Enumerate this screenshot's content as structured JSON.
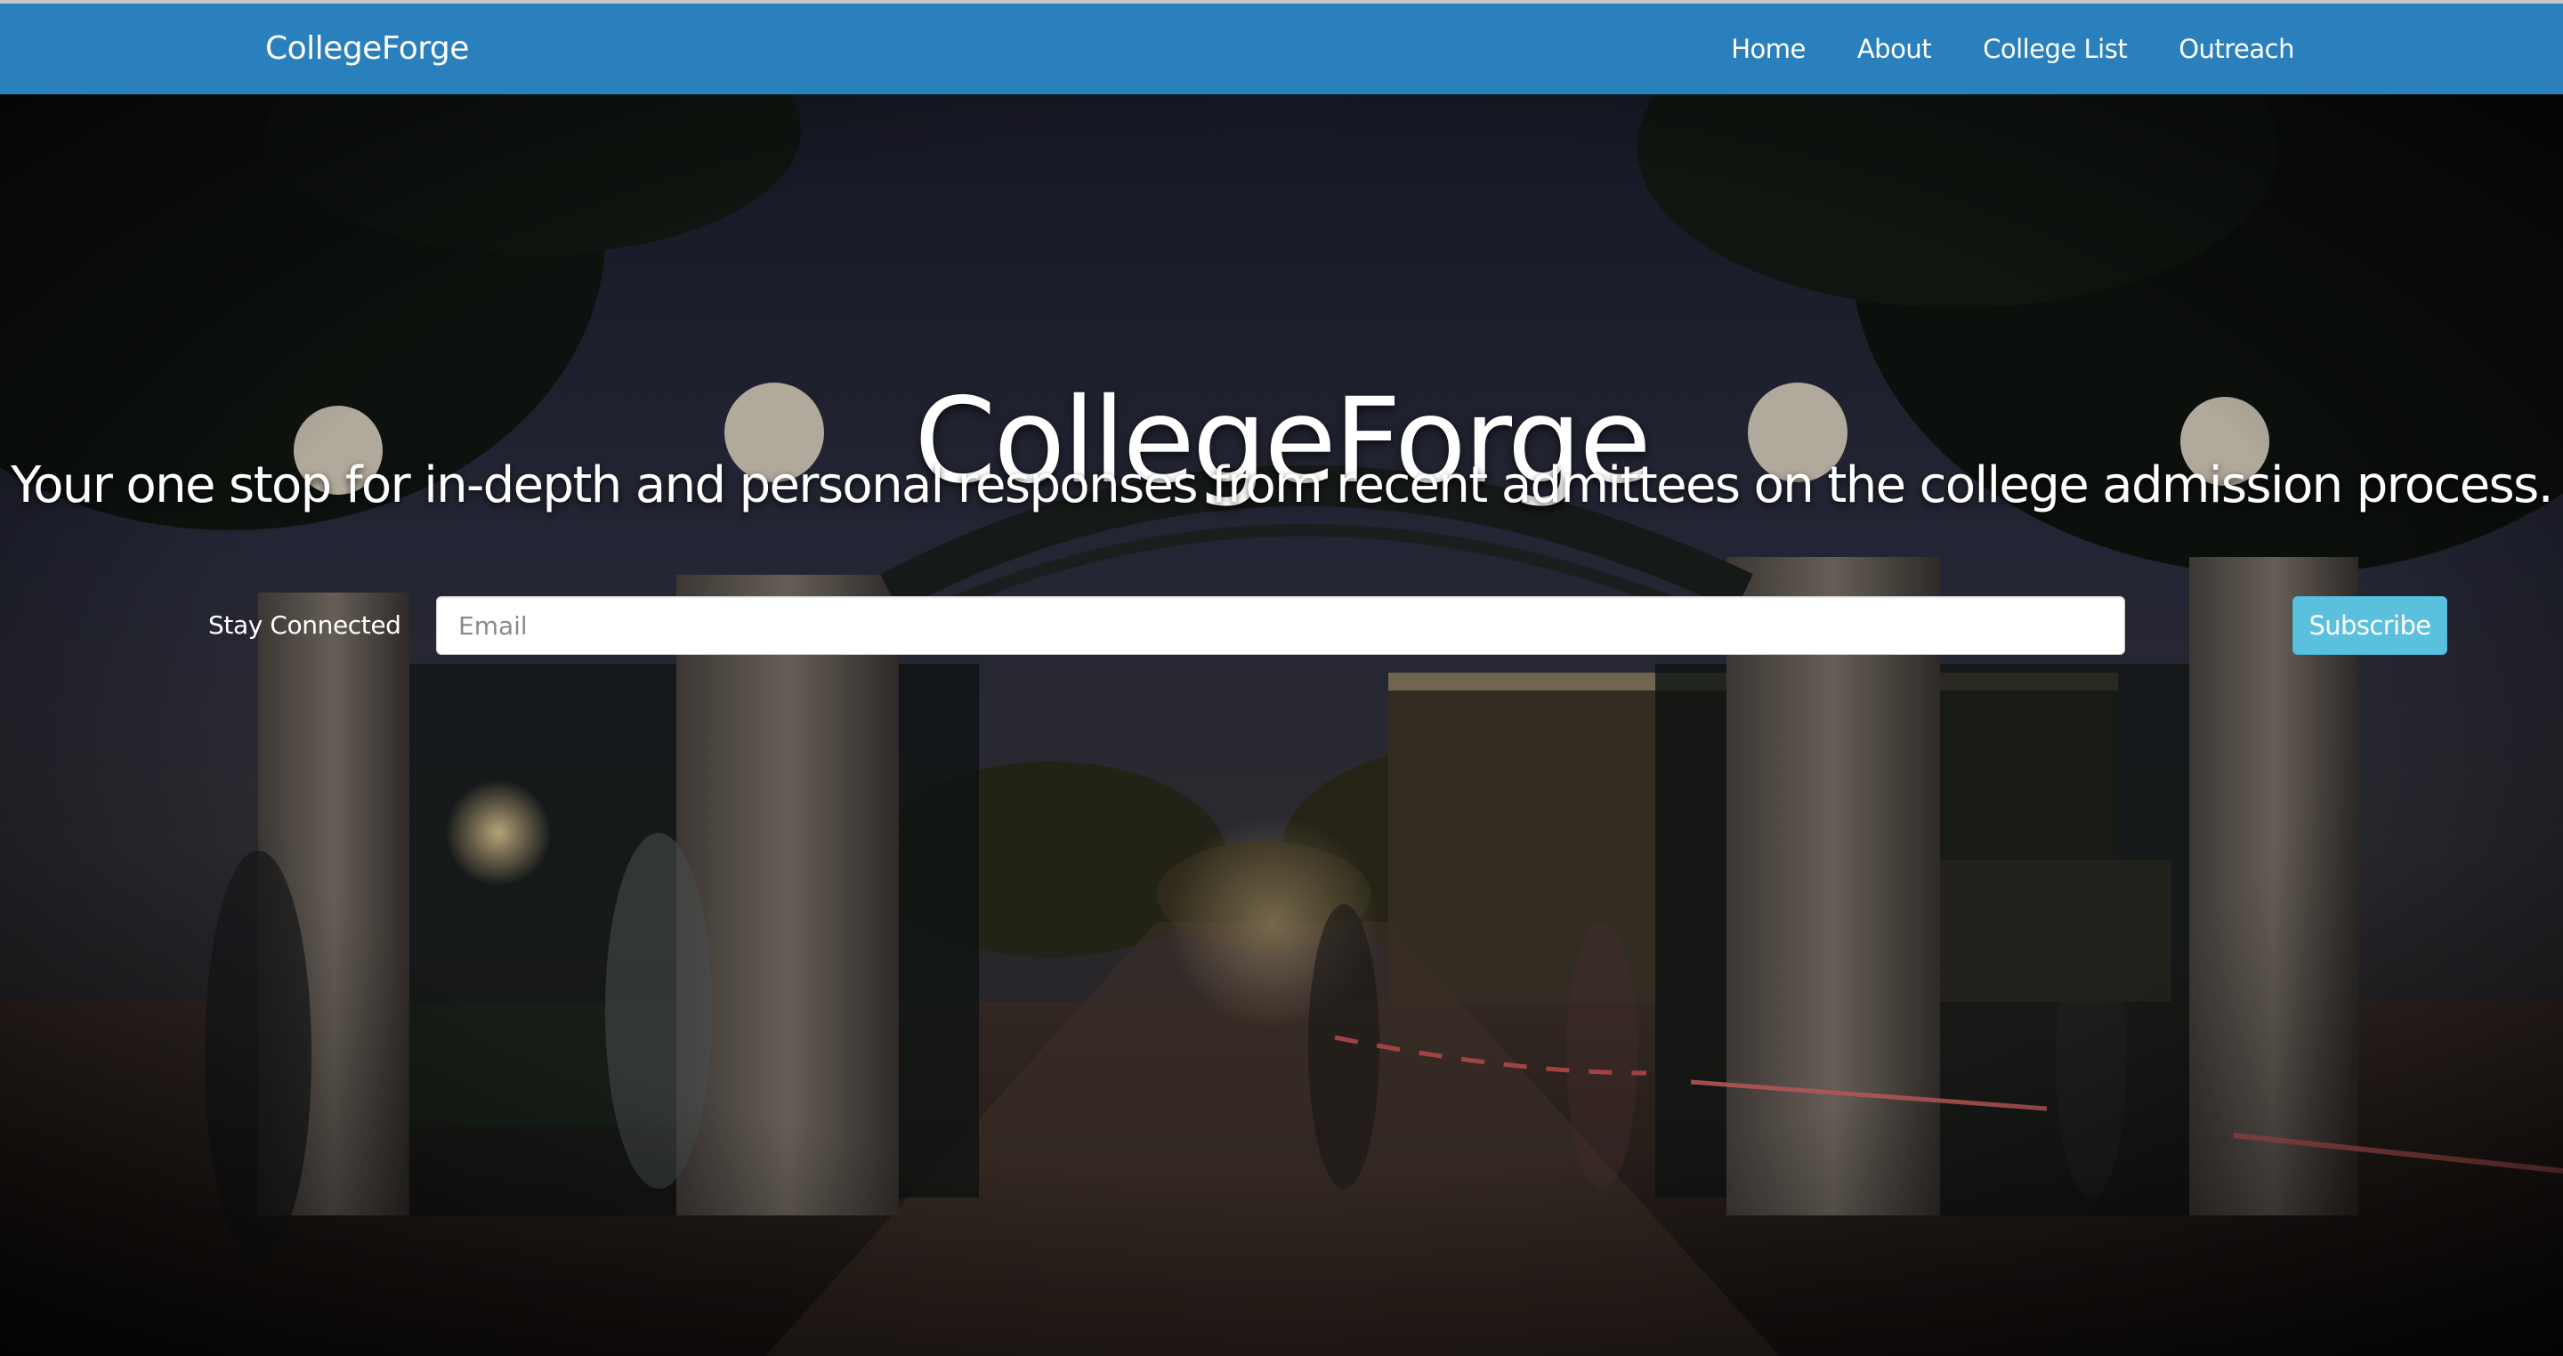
{
  "navbar": {
    "brand": "CollegeForge",
    "links": [
      "Home",
      "About",
      "College List",
      "Outreach"
    ],
    "background_color": "#2a80bd"
  },
  "hero": {
    "title": "CollegeForge",
    "subtitle": "Your one stop for in-depth and personal responses from recent admittees on the college admission process.",
    "background": "night photo of campus gate with walking students"
  },
  "subscribe": {
    "label": "Stay Connected",
    "email_placeholder": "Email",
    "email_value": "",
    "button_label": "Subscribe",
    "button_color": "#5bc0de"
  }
}
